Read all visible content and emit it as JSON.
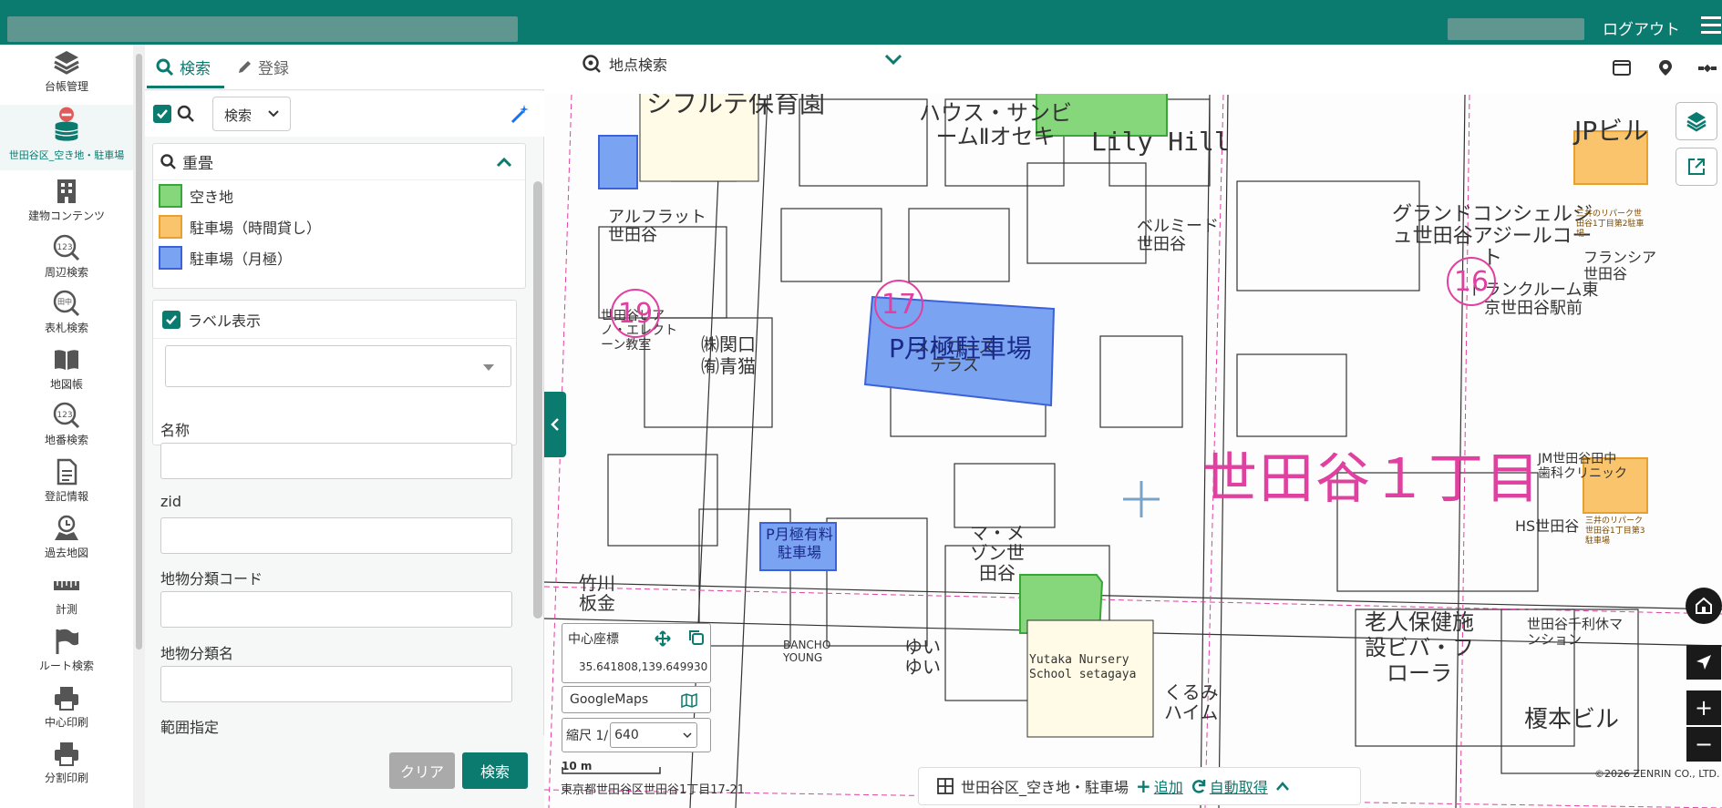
{
  "header": {
    "logout": "ログアウト"
  },
  "rail": [
    {
      "label": "台帳管理",
      "icon": "layers-icon"
    },
    {
      "label": "世田谷区_空き地・駐車場",
      "icon": "database-icon"
    },
    {
      "label": "建物コンテンツ",
      "icon": "building-icon"
    },
    {
      "label": "周辺検索",
      "icon": "number-search-icon"
    },
    {
      "label": "表札検索",
      "icon": "nameplate-search-icon"
    },
    {
      "label": "地図帳",
      "icon": "book-icon"
    },
    {
      "label": "地番検索",
      "icon": "lot-search-icon"
    },
    {
      "label": "登記情報",
      "icon": "document-icon"
    },
    {
      "label": "過去地図",
      "icon": "history-map-icon"
    },
    {
      "label": "計測",
      "icon": "ruler-icon"
    },
    {
      "label": "ルート検索",
      "icon": "flag-icon"
    },
    {
      "label": "中心印刷",
      "icon": "printer-icon"
    },
    {
      "label": "分割印刷",
      "icon": "printer-icon"
    }
  ],
  "panel": {
    "tab_search": "検索",
    "tab_register": "登録",
    "search_mode": "検索",
    "overlay_title": "重畳",
    "legend": [
      {
        "label": "空き地",
        "fill": "#86d67c",
        "border": "#3aa63a"
      },
      {
        "label": "駐車場（時間貸し）",
        "fill": "#f9c46b",
        "border": "#e8a030"
      },
      {
        "label": "駐車場（月極）",
        "fill": "#7aa3f2",
        "border": "#3b62d8"
      }
    ],
    "label_display": "ラベル表示",
    "fields": [
      {
        "label": "名称",
        "value": ""
      },
      {
        "label": "zid",
        "value": ""
      },
      {
        "label": "地物分類コード",
        "value": ""
      },
      {
        "label": "地物分類名",
        "value": ""
      },
      {
        "label": "範囲指定",
        "value": ""
      }
    ],
    "btn_clear": "クリア",
    "btn_search": "検索"
  },
  "map": {
    "location_search": "地点検索",
    "center_label": "中心座標",
    "center_value": "35.641808,139.649930",
    "googlemaps": "GoogleMaps",
    "scale_label": "縮尺 1/",
    "scale_value": "640",
    "scale_bar": "10 m",
    "address": "東京都世田谷区世田谷1丁目17-21",
    "bottom_layer": "世田谷区_空き地・駐車場",
    "bottom_add": "追加",
    "bottom_auto": "自動取得",
    "copyright": "©2026 ZENRIN CO., LTD.",
    "district_label": "世田谷１丁目",
    "labels": {
      "hoikuen": "シフルテ保育園",
      "house": "ハウス・サンビームⅡオセキ",
      "lily": "Lily Hill",
      "jp": "JPビル",
      "alphalat": "アルフラット世田谷",
      "grand": "グランドコンシェルジュ世田谷アジールコート",
      "bellmead": "ベルミード世田谷",
      "francia": "フランシア世田谷",
      "trunk": "トランクルーム東京世田谷駅前",
      "piano": "世田谷ピアノ・エレクトーン教室",
      "sekiguchi": "㈱関口",
      "aoneko": "㈲青猫",
      "melrose": "メルローズテラス",
      "monthly_big": "P月極駐車場",
      "monthly_small": "P月極有料駐車場",
      "takekawa": "竹川板金",
      "bancho": "BANCHO YOUNG",
      "mamaison": "マ・メゾン世田谷",
      "yuiyui": "ゆいゆい",
      "yutaka": "Yutaka Nursery School setagaya",
      "kurumi": "くるみハイム",
      "roujin": "老人保健施設ビバ・フローラ",
      "enomoto": "榎本ビル",
      "setagaya_senri": "世田谷千利休マンション",
      "jm": "JM世田谷田中歯科クリニック",
      "hs": "HS世田谷",
      "mitsui1": "三井のリパーク世田谷1丁目第2駐車場",
      "mitsui2": "三井のリパーク世田谷1丁目第3駐車場",
      "num19": "19",
      "num17": "17",
      "num16": "16"
    }
  }
}
